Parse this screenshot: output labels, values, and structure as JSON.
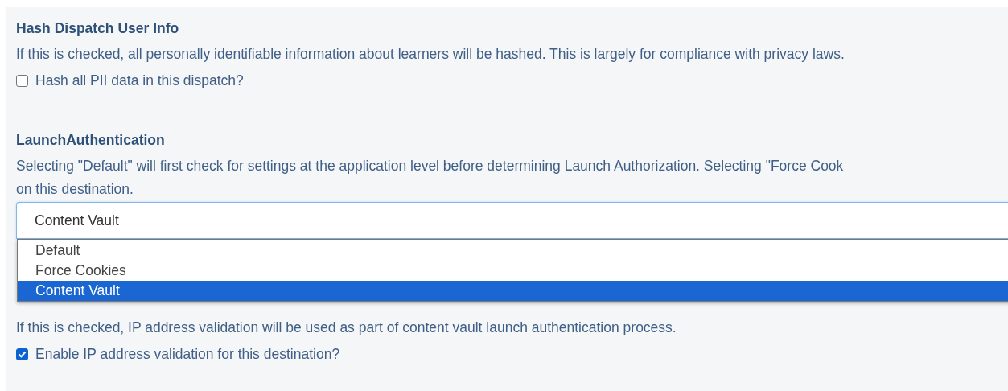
{
  "sections": [
    {
      "kind": "checkbox",
      "title": "Hash Dispatch User Info",
      "description_lines": [
        "If this is checked, all personally identifiable information about learners will be hashed. This is largely for compliance with privacy laws."
      ],
      "checkbox": {
        "label": "Hash all PII data in this dispatch?",
        "checked": false
      }
    },
    {
      "kind": "select",
      "title": "LaunchAuthentication",
      "description_lines": [
        "Selecting \"Default\" will first check for settings at the application level before determining Launch Authorization. Selecting \"Force Cook",
        "on this destination."
      ],
      "select": {
        "value": "Content Vault",
        "expanded": true,
        "options": [
          {
            "label": "Default",
            "selected": false
          },
          {
            "label": "Force Cookies",
            "selected": false
          },
          {
            "label": "Content Vault",
            "selected": true
          }
        ]
      }
    },
    {
      "kind": "checkbox",
      "description_lines": [
        "If this is checked, IP address validation will be used as part of content vault launch authentication process."
      ],
      "checkbox": {
        "label": "Enable IP address validation for this destination?",
        "checked": true
      }
    }
  ]
}
